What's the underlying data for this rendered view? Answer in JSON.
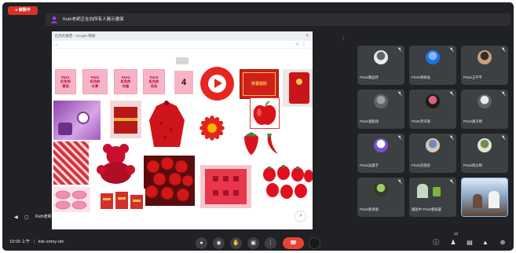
{
  "app": {
    "name": "Google Meet"
  },
  "recording": {
    "label": "● 錄製中",
    "color": "#d93025"
  },
  "banner": {
    "text": "Ruth老師正在向所有人展示畫面",
    "icon": "person-icon"
  },
  "presentation": {
    "tab_title": "紅色的東西 - Google 簡報",
    "cards": [
      [
        "P4A1",
        "紅色的",
        "東西"
      ],
      [
        "P4A2",
        "紅色的",
        "水果"
      ],
      [
        "P4A3",
        "紅色的",
        "衣服"
      ],
      [
        "P4A4",
        "紅色的",
        "花朵"
      ]
    ],
    "number_card": "4",
    "envelope_text": "恭喜發財",
    "images": [
      "purple-objects-image",
      "red-gift-box-image",
      "red-bag-image",
      "red-flower-image",
      "red-apple-image",
      "strawberry-image",
      "chili-image",
      "red-vase-image",
      "red-teddy-bear-image",
      "red-roses-image",
      "red-plate-image",
      "strawberries-image",
      "macarons-image",
      "red-snacks-image",
      "play-button-image",
      "red-envelope-image",
      "red-couplet-image"
    ]
  },
  "presenter": {
    "label": "Ruth老師"
  },
  "participants": [
    {
      "name": "PS4X陳品妤",
      "avatar": "globe",
      "color": "#e8eaed",
      "color2": "#5f6368"
    },
    {
      "name": "PS4X林宥辰",
      "avatar": "letter",
      "color": "#1a73e8",
      "color2": "#8ab4f8"
    },
    {
      "name": "PS4X王芊芊",
      "avatar": "photo",
      "color": "#c9a27e",
      "color2": "#3b2a20"
    },
    {
      "name": "PS4X張凱翔",
      "avatar": "person",
      "color": "#5f6368",
      "color2": "#9aa0a6"
    },
    {
      "name": "PS4X李沛恩",
      "avatar": "photo",
      "color": "#1b1b1b",
      "color2": "#e06080"
    },
    {
      "name": "PS4X黃子晴",
      "avatar": "person",
      "color": "#5f6368",
      "color2": "#e8eaed"
    },
    {
      "name": "PS4X吳俊宇",
      "avatar": "person",
      "color": "#7b4fd6",
      "color2": "#ffffff"
    },
    {
      "name": "PS4X許語彤",
      "avatar": "photo",
      "color": "#d9c7b0",
      "color2": "#6b8cc2"
    },
    {
      "name": "PS4X周以晴",
      "avatar": "photo",
      "color": "#e8e3d0",
      "color2": "#6d8f54"
    },
    {
      "name": "PS4X蔡承恩",
      "avatar": "image",
      "color": "#2f3a2a",
      "color2": "#9ccc65"
    },
    {
      "name": "播放中 PS4X劉家豪",
      "avatar": "video",
      "color": "#3c4043",
      "color2": "#c7d8c2"
    },
    {
      "avatar": "camera",
      "color": "#8fa9c8",
      "color2": "#5b4636",
      "active": true
    }
  ],
  "footer": {
    "time": "10:09 上午",
    "separator": "|",
    "meeting_code": "ksk-zmny-otn"
  },
  "controls": [
    "mic-icon",
    "camera-icon",
    "raise-hand-icon",
    "present-icon",
    "more-options-icon",
    "end-call-icon",
    "leave-icon"
  ],
  "side_controls": {
    "icons": [
      "info-icon",
      "people-icon",
      "chat-icon",
      "activities-icon",
      "host-controls-icon"
    ],
    "people_count": "13"
  },
  "colors": {
    "background": "#202124",
    "tile": "#3c4043",
    "accent": "#8ab4f8",
    "end_call": "#ea4335",
    "card_pink": "#f6b4c6"
  }
}
